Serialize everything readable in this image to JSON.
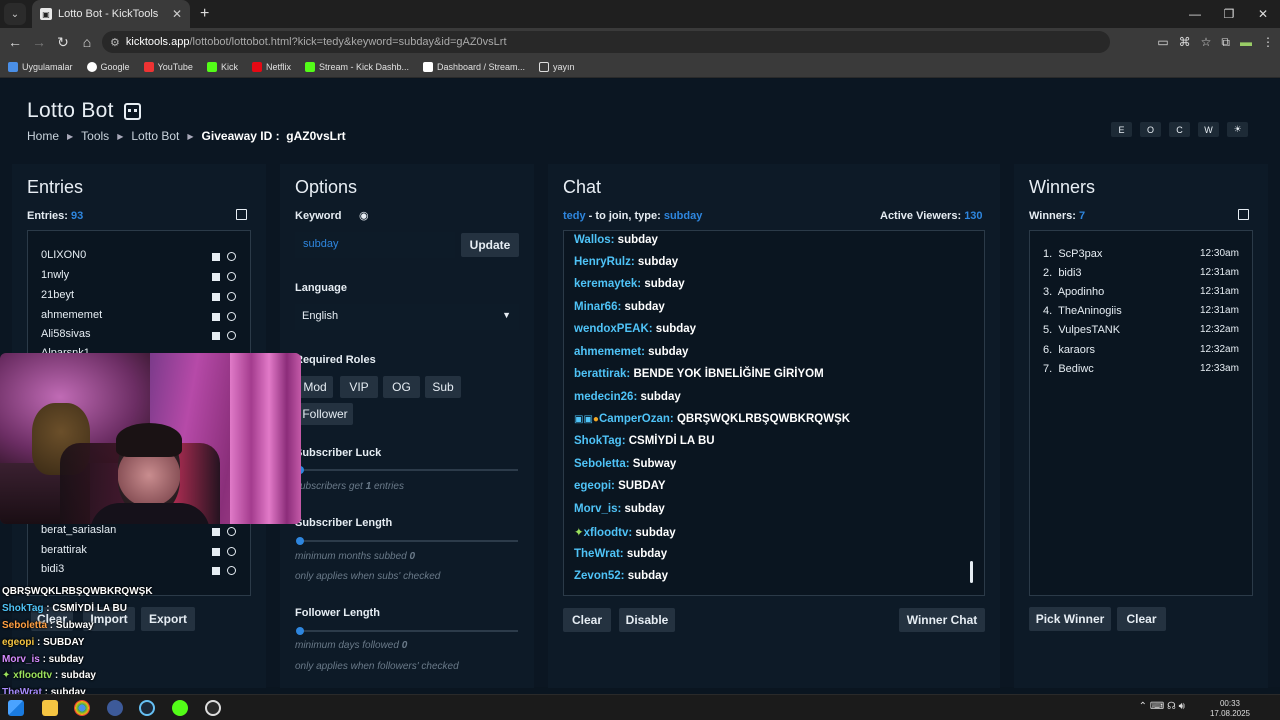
{
  "browser": {
    "tab_title": "Lotto Bot - KickTools",
    "url_host": "kicktools.app",
    "url_path": "/lottobot/lottobot.html?kick=tedy&keyword=subday&id=gAZ0vsLrt",
    "bookmarks": [
      "Uygulamalar",
      "Google",
      "YouTube",
      "Kick",
      "Netflix",
      "Stream - Kick Dashb...",
      "Dashboard / Stream...",
      "yayın"
    ]
  },
  "header": {
    "title": "Lotto Bot",
    "crumbs": [
      "Home",
      "Tools",
      "Lotto Bot"
    ],
    "giveaway_label": "Giveaway ID :",
    "giveaway_id": "gAZ0vsLrt",
    "theme_buttons": [
      "E",
      "O",
      "C",
      "W",
      "☀"
    ]
  },
  "entries": {
    "heading": "Entries",
    "count_label": "Entries:",
    "count": "93",
    "items": [
      "0LIXON0",
      "1nwly",
      "21beyt",
      "ahmememet",
      "Ali58sivas",
      "Alparsnk1",
      "berat_sariaslan",
      "berattirak",
      "bidi3"
    ],
    "buttons": [
      "Clear",
      "Import",
      "Export"
    ]
  },
  "options": {
    "heading": "Options",
    "keyword_label": "Keyword",
    "keyword_value": "subday",
    "update_label": "Update",
    "language_label": "Language",
    "language_value": "English",
    "roles_label": "Required Roles",
    "roles": [
      "Mod",
      "VIP",
      "OG",
      "Sub",
      "Follower"
    ],
    "sub_luck_label": "Subscriber Luck",
    "sub_luck_hint_a": "subscribers get",
    "sub_luck_value": "1",
    "sub_luck_hint_b": "entries",
    "sub_length_label": "Subscriber Length",
    "sub_length_hint": "minimum months subbed",
    "sub_length_value": "0",
    "sub_length_note": "only applies when subs' checked",
    "follow_length_label": "Follower Length",
    "follow_length_hint": "minimum days followed",
    "follow_length_value": "0",
    "follow_length_note": "only applies when followers' checked"
  },
  "chat": {
    "heading": "Chat",
    "join_user": "tedy",
    "join_text": " - to join, type: ",
    "join_keyword": "subday",
    "viewers_label": "Active Viewers:",
    "viewers": "130",
    "messages": [
      {
        "user": "Wallos:",
        "msg": "subday"
      },
      {
        "user": "HenryRulz:",
        "msg": "subday"
      },
      {
        "user": "keremaytek:",
        "msg": "subday"
      },
      {
        "user": "Minar66:",
        "msg": "subday"
      },
      {
        "user": "wendoxPEAK:",
        "msg": "subday"
      },
      {
        "user": "ahmememet:",
        "msg": "subday"
      },
      {
        "user": "berattirak:",
        "msg": "BENDE YOK İBNELİĞİNE GİRİYOM"
      },
      {
        "user": "medecin26:",
        "msg": "subday"
      },
      {
        "user": "CamperOzan:",
        "msg": "QBRŞWQKLRBŞQWBKRQWŞK"
      },
      {
        "user": "ShokTag:",
        "msg": "CSMİYDİ LA BU"
      },
      {
        "user": "Seboletta:",
        "msg": "Subway"
      },
      {
        "user": "egeopi:",
        "msg": "SUBDAY"
      },
      {
        "user": "Morv_is:",
        "msg": "subday"
      },
      {
        "user": "xfloodtv:",
        "msg": "subday"
      },
      {
        "user": "TheWrat:",
        "msg": "subday"
      },
      {
        "user": "Zevon52:",
        "msg": "subday"
      }
    ],
    "buttons": [
      "Clear",
      "Disable",
      "Winner Chat"
    ]
  },
  "winners": {
    "heading": "Winners",
    "count_label": "Winners:",
    "count": "7",
    "list": [
      {
        "n": "1.",
        "name": "ScP3pax",
        "time": "12:30am"
      },
      {
        "n": "2.",
        "name": "bidi3",
        "time": "12:31am"
      },
      {
        "n": "3.",
        "name": "Apodinho",
        "time": "12:31am"
      },
      {
        "n": "4.",
        "name": "TheAninogiis",
        "time": "12:31am"
      },
      {
        "n": "5.",
        "name": "VulpesTANK",
        "time": "12:32am"
      },
      {
        "n": "6.",
        "name": "karaors",
        "time": "12:32am"
      },
      {
        "n": "7.",
        "name": "Bediwc",
        "time": "12:33am"
      }
    ],
    "buttons": [
      "Pick Winner",
      "Clear"
    ]
  },
  "overlay_chat": [
    {
      "user": "",
      "msg": "QBRŞWQKLRBŞQWBKRQWŞK",
      "color": "#ffffff"
    },
    {
      "user": "ShokTag",
      "msg": " : CSMİYDİ LA BU",
      "color": "#4fc3f7"
    },
    {
      "user": "Seboletta",
      "msg": " : Subway",
      "color": "#ff9f43"
    },
    {
      "user": "egeopi",
      "msg": " : SUBDAY",
      "color": "#f5c542"
    },
    {
      "user": "Morv_is",
      "msg": " : subday",
      "color": "#d58cff"
    },
    {
      "user": "xfloodtv",
      "msg": " : subday",
      "color": "#9be15d"
    },
    {
      "user": "TheWrat",
      "msg": " : subday",
      "color": "#a78bfa"
    }
  ],
  "taskbar": {
    "time": "00:33",
    "date": "17.08.2025"
  },
  "colors": {
    "accent": "#2e86de",
    "chat_user": "#4fc3f7",
    "background": "#0b1622"
  }
}
